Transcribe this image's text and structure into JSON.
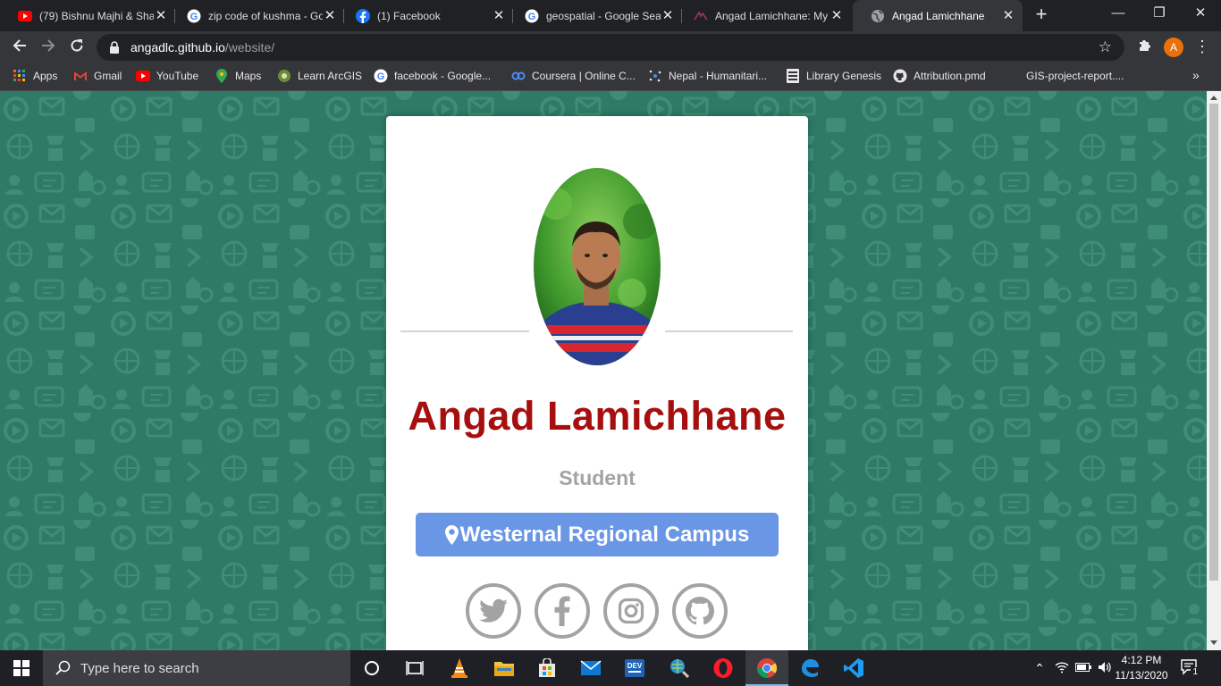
{
  "browser": {
    "tabs": [
      {
        "title": "(79) Bishnu Majhi & Sha",
        "icon": "youtube-icon"
      },
      {
        "title": "zip code of kushma - Go",
        "icon": "google-icon"
      },
      {
        "title": "(1) Facebook",
        "icon": "facebook-icon"
      },
      {
        "title": "geospatial - Google Sea",
        "icon": "google-icon"
      },
      {
        "title": "Angad Lamichhane: My",
        "icon": "site-icon"
      },
      {
        "title": "Angad Lamichhane",
        "icon": "globe-icon"
      }
    ],
    "active_tab_index": 5,
    "url_host": "angadlc.github.io",
    "url_path": "/website/",
    "profile_initial": "A",
    "bookmarks": [
      {
        "label": "Apps",
        "icon": "apps-grid-icon"
      },
      {
        "label": "Gmail",
        "icon": "gmail-icon"
      },
      {
        "label": "YouTube",
        "icon": "youtube-icon"
      },
      {
        "label": "Maps",
        "icon": "maps-icon"
      },
      {
        "label": "Learn ArcGIS",
        "icon": "arcgis-icon"
      },
      {
        "label": "facebook - Google...",
        "icon": "google-icon"
      },
      {
        "label": "Coursera | Online C...",
        "icon": "coursera-icon"
      },
      {
        "label": "Nepal - Humanitari...",
        "icon": "humanitarian-icon"
      },
      {
        "label": "Library Genesis",
        "icon": "library-icon"
      },
      {
        "label": "Attribution.pmd",
        "icon": "github-icon"
      },
      {
        "label": "GIS-project-report....",
        "icon": "document-icon"
      }
    ]
  },
  "profile": {
    "name": "Angad Lamichhane",
    "role": "Student",
    "location": "Westernal Regional Campus",
    "social": [
      "twitter-icon",
      "facebook-icon",
      "instagram-icon",
      "github-icon"
    ]
  },
  "taskbar": {
    "search_placeholder": "Type here to search",
    "time": "4:12 PM",
    "date": "11/13/2020",
    "notification_count": "1"
  },
  "colors": {
    "name": "#a70f0f",
    "role": "#a3a3a3",
    "location_button": "#6a96e6",
    "background": "#2e7a66",
    "profile_avatar": "#e8710a"
  }
}
